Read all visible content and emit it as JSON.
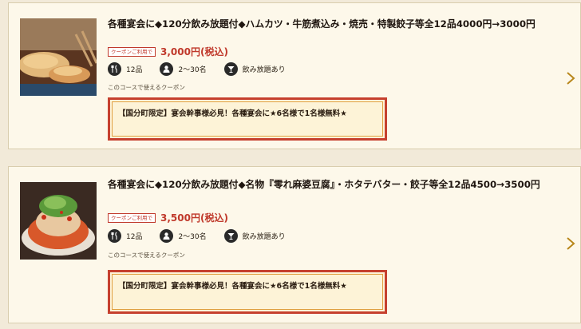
{
  "courses": [
    {
      "title": "各種宴会に◆120分飲み放題付◆ハムカツ・牛筋煮込み・焼売・特製餃子等全12品4000円→3000円",
      "coupon_tag": "クーポンご利用で",
      "price": "3,000円(税込)",
      "dishes": "12品",
      "people": "2～30名",
      "drinks": "飲み放題あり",
      "usable_label": "このコースで使えるクーポン",
      "coupon_text": "【国分町限定】宴会幹事様必見！各種宴会に★6名様で1名様無料★",
      "image_icon": "food-photo-gyoza"
    },
    {
      "title": "各種宴会に◆120分飲み放題付◆名物『零れ麻婆豆腐』・ホタテバター・餃子等全12品4500→3500円",
      "coupon_tag": "クーポンご利用で",
      "price": "3,500円(税込)",
      "dishes": "12品",
      "people": "2～30名",
      "drinks": "飲み放題あり",
      "usable_label": "このコースで使えるクーポン",
      "coupon_text": "【国分町限定】宴会幹事様必見！各種宴会に★6名様で1名様無料★",
      "image_icon": "food-photo-mapo-tofu"
    }
  ],
  "icons": {
    "dishes": "fork-knife-icon",
    "people": "person-icon",
    "drinks": "cocktail-icon",
    "chevron": "chevron-right-icon"
  },
  "colors": {
    "accent_red": "#c0392b",
    "coupon_bg": "#fdf3d7",
    "card_bg": "#fdf8ea",
    "page_bg": "#f2ead9"
  }
}
